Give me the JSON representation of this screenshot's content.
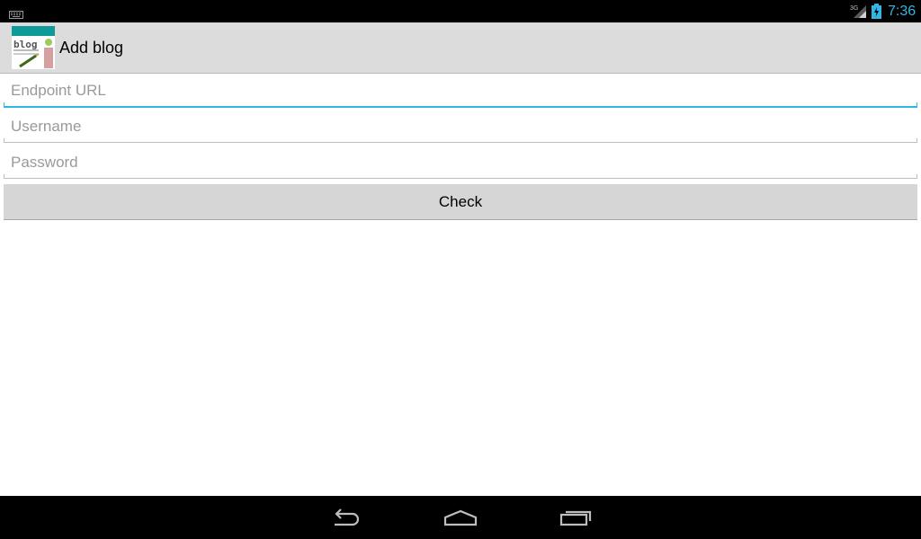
{
  "status_bar": {
    "time": "7:36",
    "network": "3G",
    "icons": [
      "keyboard-icon",
      "signal-icon",
      "battery-charging-icon"
    ],
    "accent_color": "#33b5e5"
  },
  "action_bar": {
    "title": "Add blog",
    "app_icon": "blog-app-icon",
    "app_icon_text": "blog"
  },
  "form": {
    "endpoint": {
      "placeholder": "Endpoint URL",
      "value": ""
    },
    "username": {
      "placeholder": "Username",
      "value": ""
    },
    "password": {
      "placeholder": "Password",
      "value": ""
    },
    "check_label": "Check"
  },
  "nav_bar": {
    "icons": [
      "back-icon",
      "home-icon",
      "recent-apps-icon"
    ]
  }
}
